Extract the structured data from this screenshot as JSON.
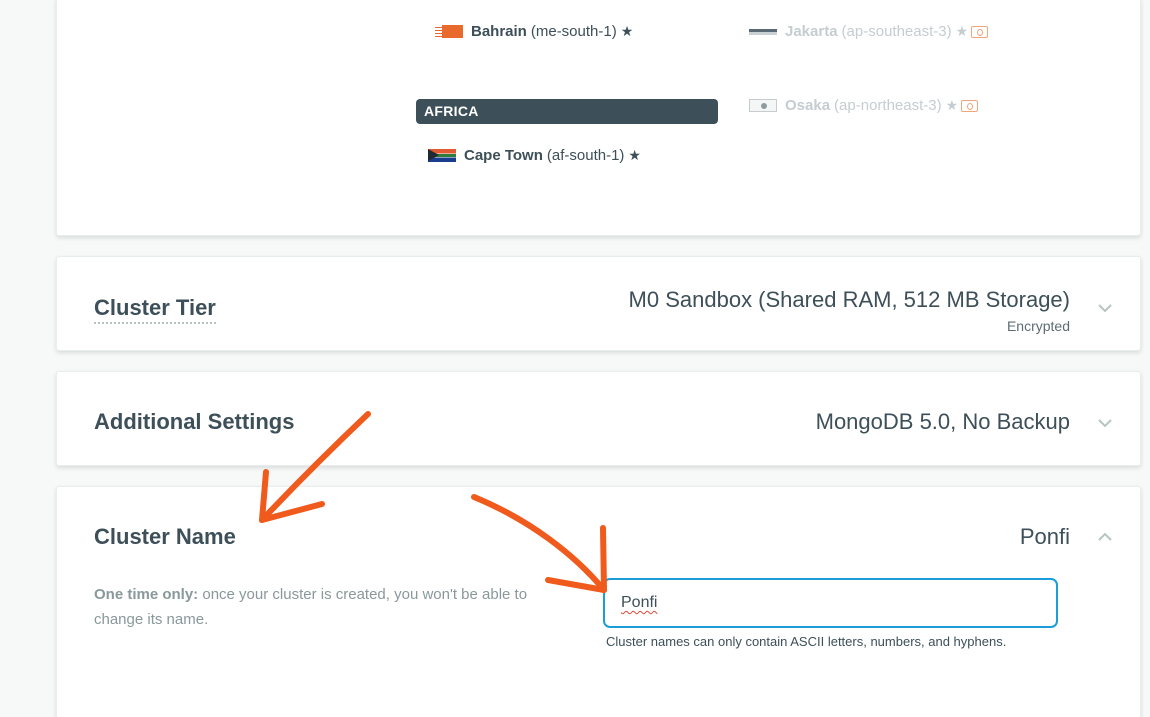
{
  "regions": {
    "middle_east": [
      {
        "name": "Bahrain",
        "code": "(me-south-1)",
        "flag": "bahrain-flag-icon",
        "star": true,
        "disabled": false
      }
    ],
    "africa_header": "AFRICA",
    "africa": [
      {
        "name": "Cape Town",
        "code": "(af-south-1)",
        "flag": "south-africa-flag-icon",
        "star": true,
        "disabled": false
      }
    ],
    "asia_more": [
      {
        "name": "Jakarta",
        "code": "(ap-southeast-3)",
        "flag": "indonesia-flag-icon",
        "star": true,
        "gift": true,
        "disabled": true
      },
      {
        "name": "Osaka",
        "code": "(ap-northeast-3)",
        "flag": "japan-flag-icon",
        "star": true,
        "gift": true,
        "disabled": true
      }
    ]
  },
  "cluster_tier": {
    "title": "Cluster Tier",
    "value": "M0 Sandbox (Shared RAM, 512 MB Storage)",
    "subvalue": "Encrypted",
    "chevron": "chevron-down-icon"
  },
  "additional_settings": {
    "title": "Additional Settings",
    "value": "MongoDB 5.0, No Backup",
    "chevron": "chevron-down-icon"
  },
  "cluster_name": {
    "title": "Cluster Name",
    "value": "Ponfi",
    "chevron": "chevron-up-icon",
    "desc_bold": "One time only:",
    "desc_rest": " once your cluster is created, you won't be able to change its name.",
    "input_value": "Ponfi",
    "help": "Cluster names can only contain ASCII letters, numbers, and hyphens."
  },
  "colors": {
    "accent": "#1a9dd9",
    "text": "#3d4f58",
    "annotation_arrow": "#f05a1c",
    "header_bg": "#3d4f58"
  },
  "star_glyph": "★"
}
